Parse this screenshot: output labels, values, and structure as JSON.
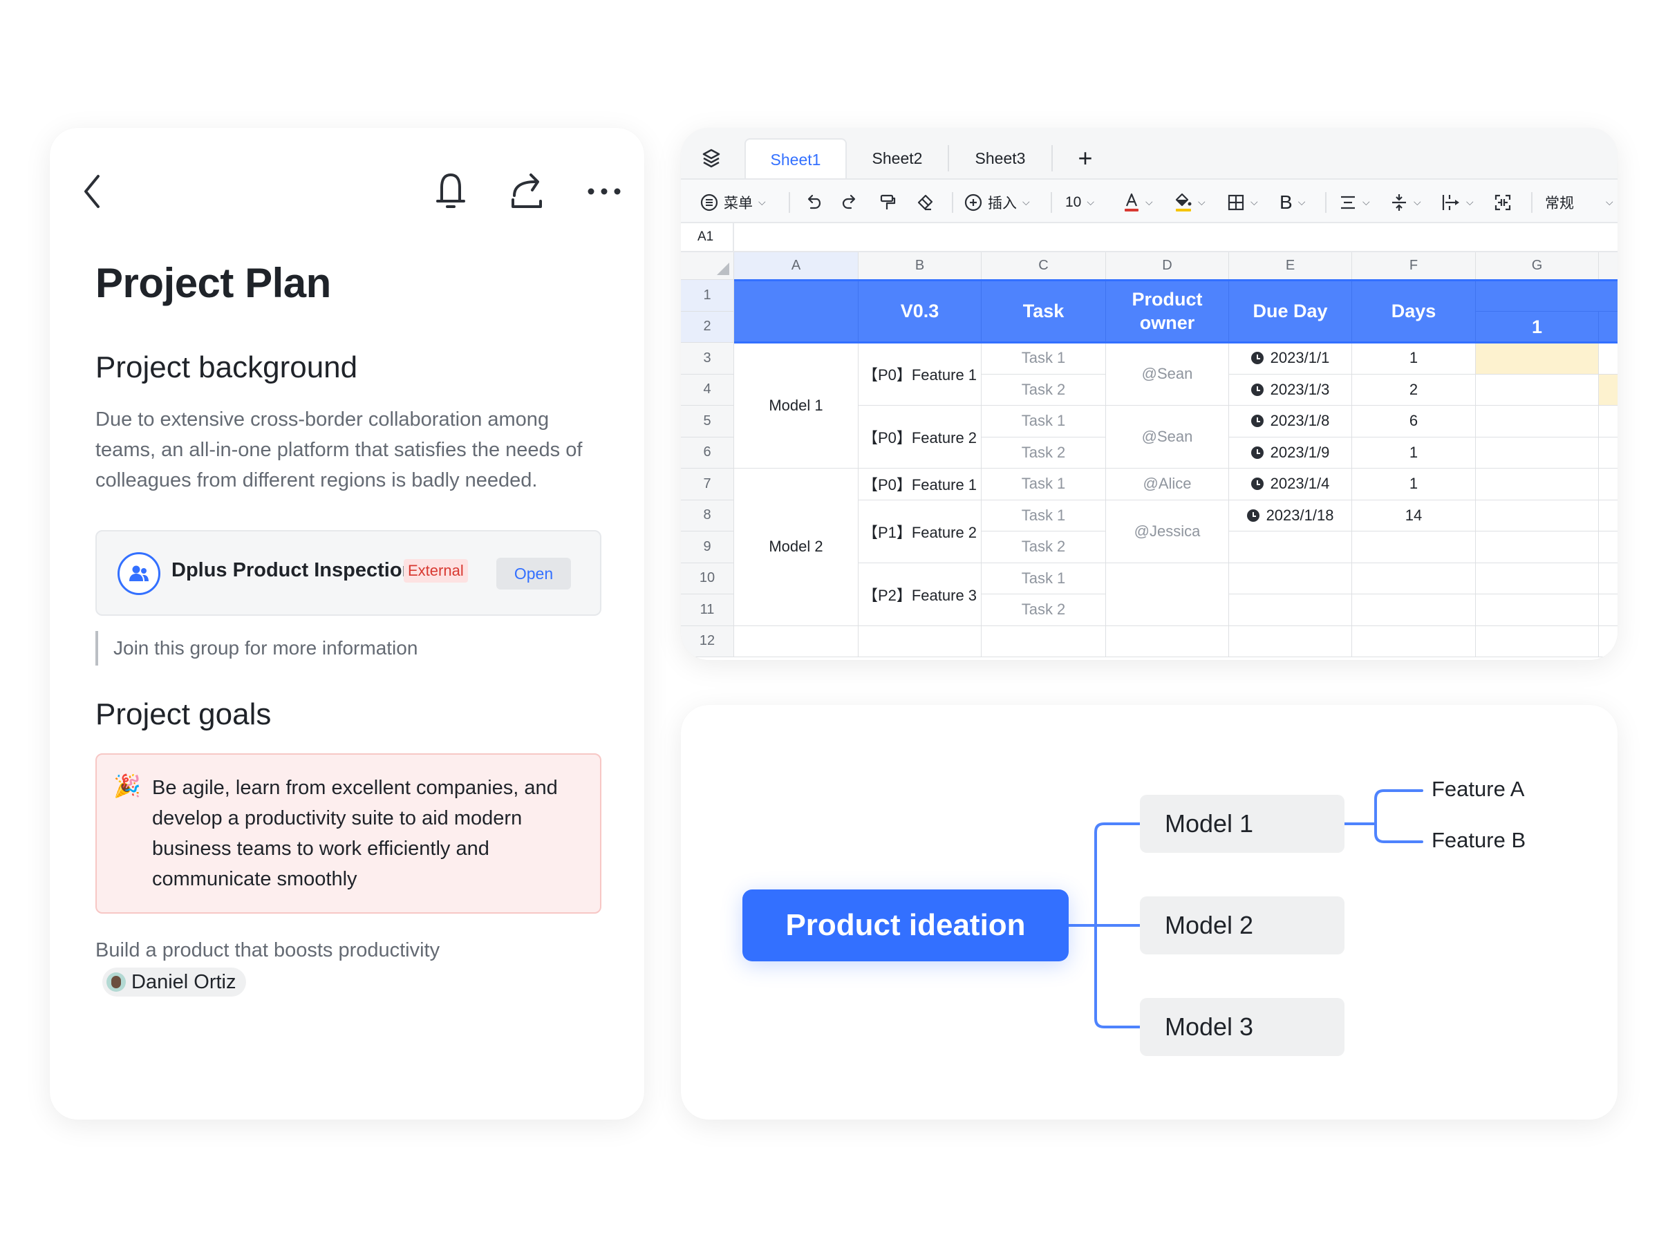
{
  "doc": {
    "title": "Project Plan",
    "toolbar_icons": [
      "back-icon",
      "bell-icon",
      "share-icon",
      "more-icon"
    ],
    "background": {
      "heading": "Project background",
      "text": "Due to extensive cross-border collaboration among teams, an all-in-one platform that satisfies the needs of colleagues from different regions is badly needed."
    },
    "group_card": {
      "name": "Dplus Product Inspection",
      "badge": "External",
      "button": "Open",
      "icon": "group-icon"
    },
    "quote": "Join this group for more information",
    "goals": {
      "heading": "Project goals",
      "emoji": "🎉",
      "callout": "Be agile, learn from excellent companies, and develop a productivity suite to aid modern business teams to work efficiently and communicate smoothly",
      "text": "Build a product that boosts productivity",
      "mention": "Daniel Ortiz"
    }
  },
  "sheet": {
    "tabs": [
      "Sheet1",
      "Sheet2",
      "Sheet3"
    ],
    "active_tab": "Sheet1",
    "add_tab": "+",
    "toolbar": {
      "menu": "菜单",
      "insert": "插入",
      "font_size": "10",
      "format": "常规"
    },
    "cell_ref": "A1",
    "columns": [
      "A",
      "B",
      "C",
      "D",
      "E",
      "F",
      "G"
    ],
    "rows": [
      "1",
      "2",
      "3",
      "4",
      "5",
      "6",
      "7",
      "8",
      "9",
      "10",
      "11",
      "12"
    ],
    "header": {
      "b": "V0.3",
      "c": "Task",
      "d": "Product owner",
      "e": "Due Day",
      "f": "Days",
      "g": "1"
    },
    "cells": {
      "a_model1": "Model 1",
      "a_model2": "Model 2",
      "b_r3": "【P0】Feature 1",
      "b_r5": "【P0】Feature 2",
      "b_r7": "【P0】Feature 1",
      "b_r8": "【P1】Feature 2",
      "b_r10": "【P2】Feature 3",
      "c": [
        "Task 1",
        "Task 2",
        "Task 1",
        "Task 2",
        "Task 1",
        "Task 1",
        "Task 2",
        "Task 1",
        "Task 2"
      ],
      "d_r3": "@Sean",
      "d_r5": "@Sean",
      "d_r7": "@Alice",
      "d_r8": "@Jessica",
      "e": [
        "2023/1/1",
        "2023/1/3",
        "2023/1/8",
        "2023/1/9",
        "2023/1/4",
        "2023/1/18"
      ],
      "f": [
        "1",
        "2",
        "6",
        "1",
        "1",
        "14"
      ]
    },
    "colors": {
      "header": "#4e83fd",
      "highlight": "#fdf2cf",
      "accent": "#3370ff"
    }
  },
  "mindmap": {
    "root": "Product ideation",
    "children": [
      "Model 1",
      "Model 2",
      "Model 3"
    ],
    "leaves": [
      "Feature A",
      "Feature B"
    ],
    "colors": {
      "root": "#3370ff",
      "line": "#4e83fd",
      "node": "#eff0f1"
    }
  }
}
